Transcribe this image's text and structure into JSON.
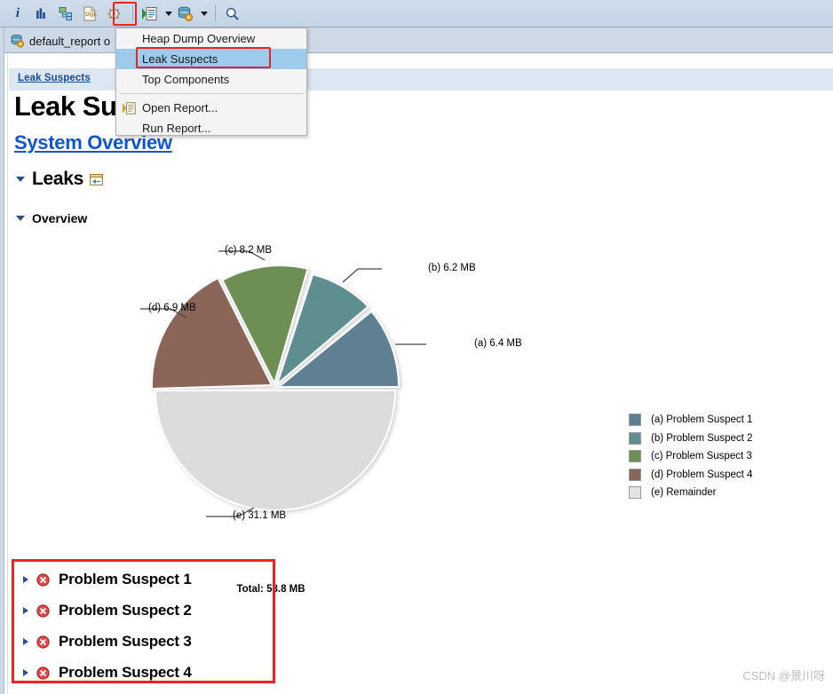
{
  "toolbar": {
    "buttons": [
      {
        "name": "info-icon",
        "label": "i"
      },
      {
        "name": "histogram-icon",
        "label": ""
      },
      {
        "name": "dominator-tree-icon",
        "label": ""
      },
      {
        "name": "oql-icon",
        "label": "OQL"
      },
      {
        "name": "query-browser-icon",
        "label": ""
      },
      {
        "name": "report-icon",
        "label": ""
      },
      {
        "name": "heap-dump-icon",
        "label": ""
      },
      {
        "name": "search-icon",
        "label": ""
      }
    ]
  },
  "tab": {
    "label": "default_report o",
    "icon": "heap-dump-icon"
  },
  "menu": {
    "items": [
      {
        "label": "Heap Dump Overview",
        "selected": false,
        "icon": ""
      },
      {
        "label": "Leak Suspects",
        "selected": true,
        "icon": ""
      },
      {
        "label": "Top Components",
        "selected": false,
        "icon": ""
      },
      {
        "label": "Open Report...",
        "selected": false,
        "icon": "report-icon"
      },
      {
        "label": "Run Report...",
        "selected": false,
        "icon": ""
      }
    ],
    "separator_after_index": 2
  },
  "content": {
    "breadcrumb": "Leak Suspects",
    "page_title": "Leak Su",
    "page_title_full": "Leak Suspects",
    "system_overview_link": "System Overview",
    "section_leaks": "Leaks",
    "section_overview": "Overview"
  },
  "chart_data": {
    "type": "pie",
    "title": "",
    "total_label": "Total: 58.8 MB",
    "unit": "MB",
    "total": 58.8,
    "legend_position": "right",
    "categories": [
      "(a) Problem Suspect 1",
      "(b) Problem Suspect 2",
      "(c) Problem Suspect 3",
      "(d) Problem Suspect 4",
      "(e) Remainder"
    ],
    "keys": [
      "(a)",
      "(b)",
      "(c)",
      "(d)",
      "(e)"
    ],
    "values": [
      6.4,
      6.2,
      8.2,
      6.9,
      31.1
    ],
    "value_labels": [
      "(a)  6.4 MB",
      "(b)  6.2 MB",
      "(c)  8.2 MB",
      "(d)  6.9 MB",
      "(e)  31.1 MB"
    ],
    "colors": [
      "#5e7f93",
      "#5e8e90",
      "#6e8f53",
      "#8b6659",
      "#dcdcdc"
    ],
    "legend": [
      {
        "label": "(a) Problem Suspect 1",
        "color": "#5e7f93"
      },
      {
        "label": "(b) Problem Suspect 2",
        "color": "#5e8e90"
      },
      {
        "label": "(c) Problem Suspect 3",
        "color": "#6e8f53"
      },
      {
        "label": "(d) Problem Suspect 4",
        "color": "#8b6659"
      },
      {
        "label": "(e) Remainder",
        "color": "#dcdcdc"
      }
    ]
  },
  "suspects": [
    {
      "label": "Problem Suspect 1"
    },
    {
      "label": "Problem Suspect 2"
    },
    {
      "label": "Problem Suspect 3"
    },
    {
      "label": "Problem Suspect 4"
    }
  ],
  "watermark": "CSDN @景川呀",
  "colors": {
    "highlight": "#ee2222",
    "toolbar": "#c9d8e8",
    "breadcrumb_band": "#dde7f2",
    "link": "#1155cc",
    "menu_selected": "#9ccbeb"
  }
}
